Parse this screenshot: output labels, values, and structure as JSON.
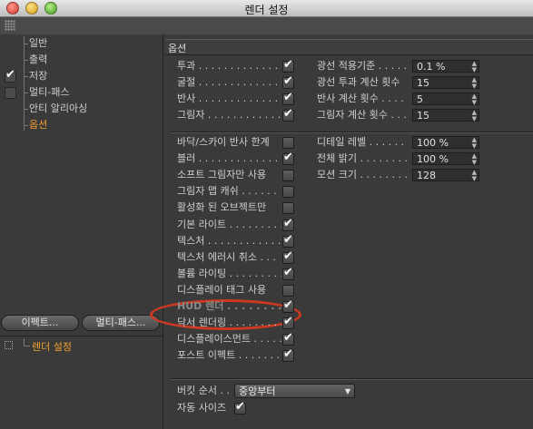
{
  "window": {
    "title": "렌더 설정"
  },
  "tree": {
    "items": [
      {
        "label": "일반",
        "checked": null,
        "selected": false
      },
      {
        "label": "출력",
        "checked": null,
        "selected": false
      },
      {
        "label": "저장",
        "checked": true,
        "selected": false
      },
      {
        "label": "멀티-패스",
        "checked": false,
        "selected": false
      },
      {
        "label": "안티 알리아싱",
        "checked": null,
        "selected": false
      },
      {
        "label": "옵션",
        "checked": null,
        "selected": true
      }
    ],
    "effect_button": "이펙트...",
    "multipass_button": "멀티-패스...",
    "render_setting_node": "렌더 설정"
  },
  "options": {
    "section_title": "옵션",
    "left_group1": [
      {
        "label": "투과 . . . . . . . . . . . . . . . .",
        "checked": true
      },
      {
        "label": "굴절 . . . . . . . . . . . . . . . .",
        "checked": true
      },
      {
        "label": "반사 . . . . . . . . . . . . . . . .",
        "checked": true
      },
      {
        "label": "그림자 . . . . . . . . . . . . . .",
        "checked": true
      }
    ],
    "right_group1": [
      {
        "label": "광선 적용기준 . . . . .",
        "value": "0.1 %"
      },
      {
        "label": "광선 투과 계산 횟수",
        "value": "15"
      },
      {
        "label": "반사 계산 횟수 . . . .",
        "value": "5"
      },
      {
        "label": "그림자 계산 횟수 . . .",
        "value": "15"
      }
    ],
    "left_group2": [
      {
        "label": "바닥/스카이 반사 한계",
        "checked": false
      },
      {
        "label": "블러 . . . . . . . . . . . . . . . .",
        "checked": true
      },
      {
        "label": "소프트 그림자만 사용",
        "checked": false
      },
      {
        "label": "그림자 맵 캐쉬 . . . . . .",
        "checked": false
      },
      {
        "label": "활성화 된 오브젝트만",
        "checked": false
      },
      {
        "label": "기본 라이트 . . . . . . . . . .",
        "checked": true
      },
      {
        "label": "텍스처 . . . . . . . . . . . . . .",
        "checked": true
      },
      {
        "label": "텍스처 에러시 취소 . . .",
        "checked": true
      },
      {
        "label": "볼륨 라이팅 . . . . . . . . .",
        "checked": true
      },
      {
        "label": "디스플레이 태그 사용",
        "checked": false
      },
      {
        "label": "HUD 렌더 . . . . . . . . . . .",
        "checked": true
      },
      {
        "label": "닥서 렌더링 . . . . . . . . .",
        "checked": true
      },
      {
        "label": "디스플레이스먼트 . . . . .",
        "checked": true
      },
      {
        "label": "포스트 이펙트 . . . . . . . .",
        "checked": true
      }
    ],
    "right_group2": [
      {
        "label": "디테일 레벨 . . . . . . .",
        "value": "100 %"
      },
      {
        "label": "전체 밝기 . . . . . . . . .",
        "value": "100 %"
      },
      {
        "label": "모션 크기 . . . . . . . . .",
        "value": "128"
      }
    ],
    "bucket_label": "버킷 순서 . .",
    "bucket_value": "중앙부터",
    "autosize_label": "자동 사이즈",
    "autosize_checked": true
  },
  "colors": {
    "selected_text": "#f0a030",
    "highlight_ellipse": "#cc3820"
  }
}
